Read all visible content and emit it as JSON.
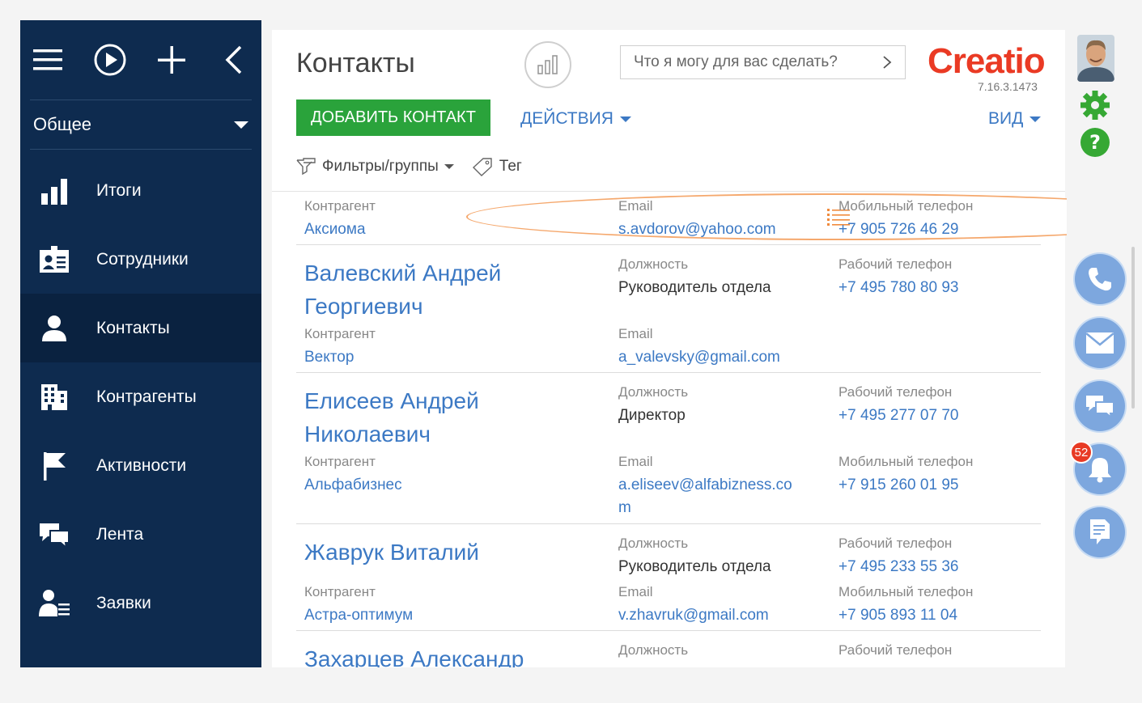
{
  "sidebar": {
    "section": "Общее",
    "items": [
      {
        "label": "Итоги",
        "icon": "bar-chart-icon"
      },
      {
        "label": "Сотрудники",
        "icon": "employee-badge-icon"
      },
      {
        "label": "Контакты",
        "icon": "person-icon"
      },
      {
        "label": "Контрагенты",
        "icon": "building-icon"
      },
      {
        "label": "Активности",
        "icon": "flag-icon"
      },
      {
        "label": "Лента",
        "icon": "chat-icon"
      },
      {
        "label": "Заявки",
        "icon": "person-list-icon"
      }
    ]
  },
  "header": {
    "title": "Контакты",
    "command_placeholder": "Что я могу для вас сделать?",
    "logo": "Creatio",
    "version": "7.16.3.1473",
    "add_button": "ДОБАВИТЬ КОНТАКТ",
    "actions": "ДЕЙСТВИЯ",
    "view": "ВИД",
    "filters": "Фильтры/группы",
    "tag": "Тег"
  },
  "records": [
    {
      "org_label": "Контрагент",
      "org": "Аксиома",
      "email_label": "Email",
      "email": "s.avdorov@yahoo.com",
      "phone_label": "Мобильный телефон",
      "phone": "+7 905 726 46 29"
    },
    {
      "name_line1": "Валевский Андрей",
      "name_line2": "Георгиевич",
      "pos_label": "Должность",
      "position": "Руководитель отдела",
      "work_label": "Рабочий телефон",
      "work_phone": "+7 495 780 80 93",
      "org_label": "Контрагент",
      "org": "Вектор",
      "email_label": "Email",
      "email": "a_valevsky@gmail.com"
    },
    {
      "name_line1": "Елисеев Андрей",
      "name_line2": "Николаевич",
      "pos_label": "Должность",
      "position": "Директор",
      "work_label": "Рабочий телефон",
      "work_phone": "+7 495 277 07 70",
      "org_label": "Контрагент",
      "org": "Альфабизнес",
      "email_label": "Email",
      "email_line1": "a.eliseev@alfabizness.co",
      "email_line2": "m",
      "mob_label": "Мобильный телефон",
      "mob_phone": "+7 915 260 01 95"
    },
    {
      "name_line1": "Жаврук Виталий",
      "pos_label": "Должность",
      "position": "Руководитель отдела",
      "work_label": "Рабочий телефон",
      "work_phone": "+7 495 233 55 36",
      "org_label": "Контрагент",
      "org": "Астра-оптимум",
      "email_label": "Email",
      "email": "v.zhavruk@gmail.com",
      "mob_label": "Мобильный телефон",
      "mob_phone": "+7 905 893 11 04"
    },
    {
      "name_line1": "Захарцев Александр",
      "pos_label": "Должность",
      "work_label": "Рабочий телефон"
    }
  ],
  "right_panel": {
    "notification_count": "52"
  },
  "colors": {
    "sidebar": "#0e2b4f",
    "accent_blue": "#3c79c4",
    "add_green": "#2aa33b",
    "logo_red": "#ea3a24",
    "comm_button": "#7da7de"
  }
}
